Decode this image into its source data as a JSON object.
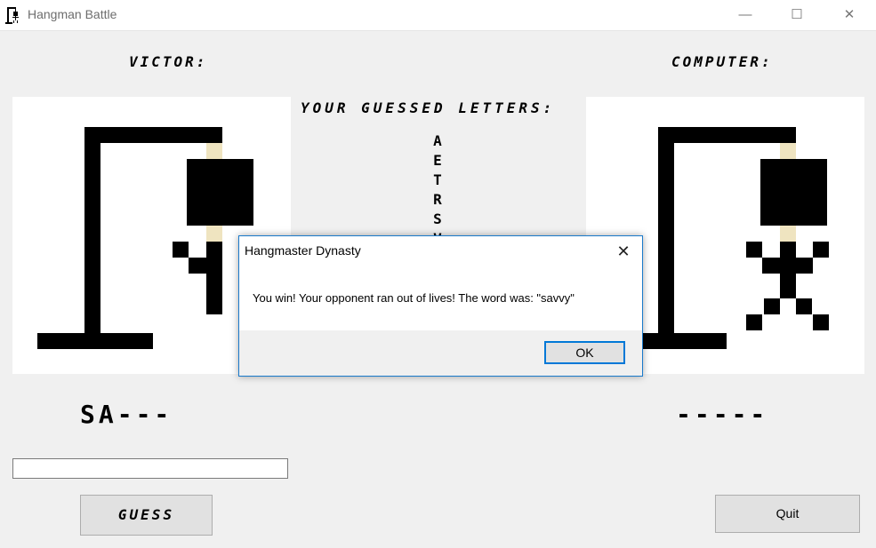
{
  "window": {
    "title": "Hangman Battle",
    "min_glyph": "—",
    "max_glyph": "☐",
    "close_glyph": "✕"
  },
  "player": {
    "name": "VICTOR:",
    "word_display": "SA---"
  },
  "computer": {
    "name": "COMPUTER:",
    "word_display": "-----"
  },
  "guessed": {
    "title": "YOUR GUESSED LETTERS:",
    "letters": [
      "A",
      "E",
      "T",
      "R",
      "S",
      "V"
    ]
  },
  "input": {
    "value": ""
  },
  "buttons": {
    "guess": "GUESS",
    "quit": "Quit"
  },
  "dialog": {
    "title": "Hangmaster Dynasty",
    "close_glyph": "✕",
    "message": "You win! Your opponent ran out of lives! The word was: \"savvy\"",
    "ok": "OK"
  },
  "colors": {
    "rope": "#efe4c0",
    "accent": "#0078d7"
  }
}
